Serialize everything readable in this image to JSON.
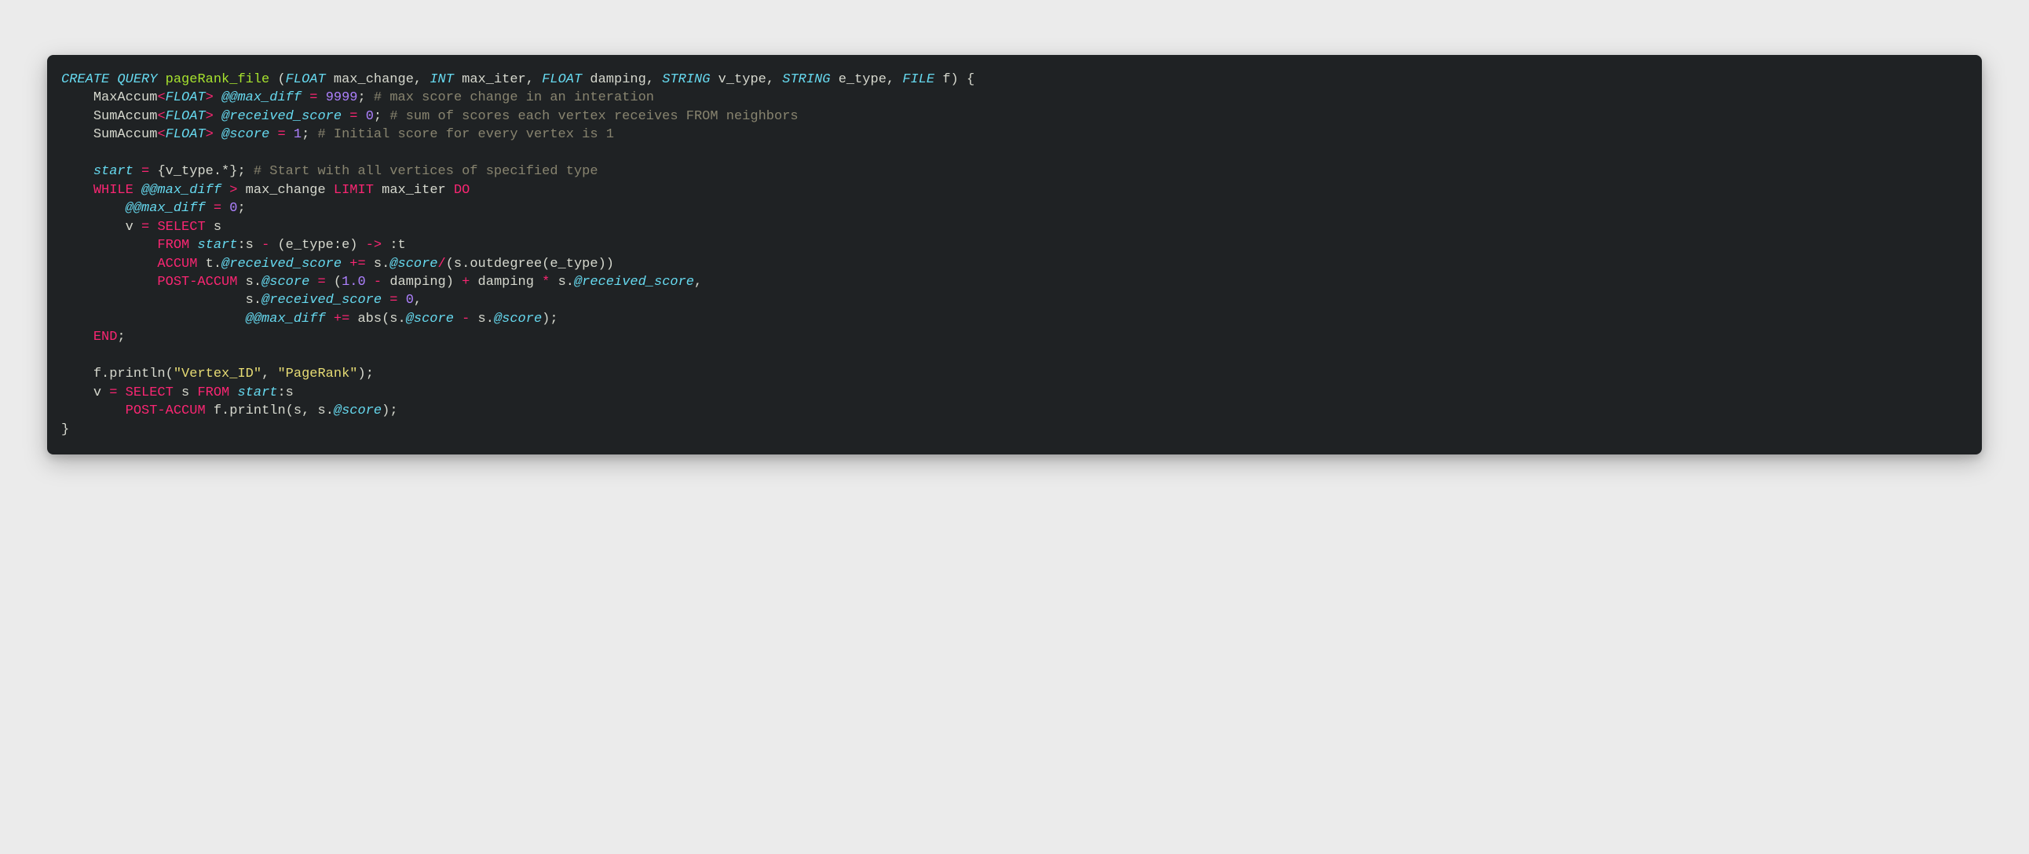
{
  "code": {
    "t": {
      "create": "CREATE",
      "query": "QUERY",
      "fn": "pageRank_file",
      "float": "FLOAT",
      "int": "INT",
      "string": "STRING",
      "file": "FILE",
      "p_max_change": "max_change",
      "p_max_iter": "max_iter",
      "p_damping": "damping",
      "p_v_type": "v_type",
      "p_e_type": "e_type",
      "p_f": "f",
      "maxaccum": "MaxAccum",
      "sumaccum": "SumAccum",
      "at_at_max_diff": "@@max_diff",
      "at_received_score": "@received_score",
      "at_score": "@score",
      "n_9999": "9999",
      "n_0": "0",
      "n_1": "1",
      "n_1_0": "1.0",
      "c_max_change": "# max score change in an interation",
      "c_sum_scores": "# sum of scores each vertex receives FROM neighbors",
      "c_initial": "# Initial score for every vertex is 1",
      "c_start": "# Start with all vertices of specified type",
      "start": "start",
      "v_type_star": "{v_type.*};",
      "while": "WHILE",
      "limit": "LIMIT",
      "do": "DO",
      "select": "SELECT",
      "from": "FROM",
      "accum": "ACCUM",
      "postaccum": "POST-ACCUM",
      "end": "END",
      "println": "f.println",
      "str_vertex_id": "\"Vertex_ID\"",
      "str_pagerank": "\"PageRank\"",
      "abs": "abs",
      "outdegree": "outdegree",
      "s": "s",
      "t": "t",
      "v": "v",
      "e": "e",
      "colon_s": ":s",
      "colon_t": ":t",
      "colon_e": ":e",
      "eq": "=",
      "semi": ";",
      "comma": ",",
      "lparen": "(",
      "rparen": ")",
      "lbrace": "{",
      "rbrace": "}",
      "lt": "<",
      "gt": ">",
      "plus_eq": "+=",
      "slash": "/",
      "minus": "-",
      "plus": "+",
      "star": "*",
      "arrow": "->",
      "dash": "-",
      "dot": "."
    }
  }
}
